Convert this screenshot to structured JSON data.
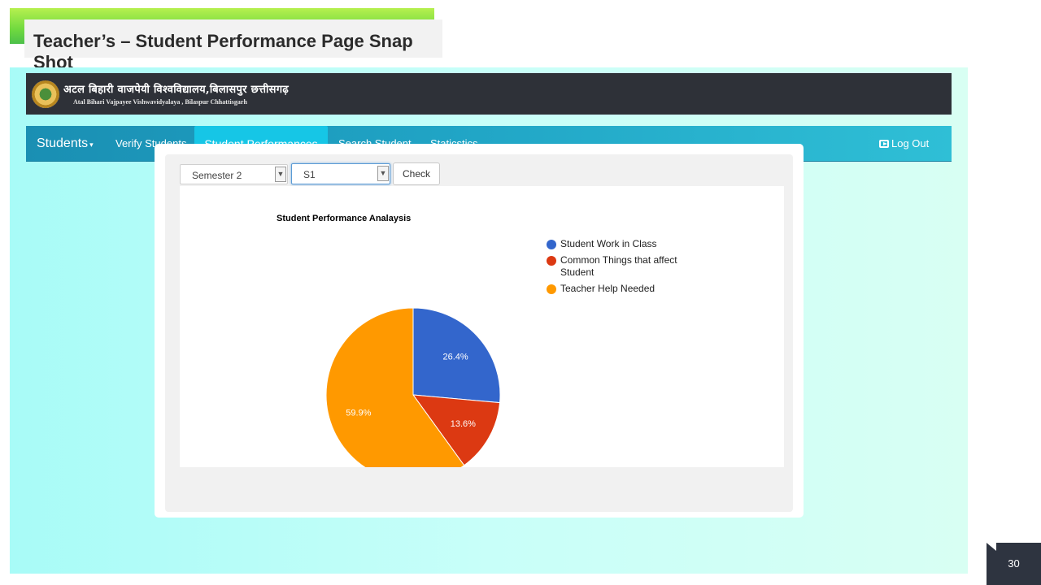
{
  "slide": {
    "title": "Teacher’s – Student Performance Page Snap Shot",
    "page_number": "30"
  },
  "header": {
    "university_hindi": "अटल बिहारी वाजपेयी विश्वविद्यालय,बिलासपुर छत्तीसगढ़",
    "university_english": "Atal Bihari Vajpayee Vishwavidyalaya , Bilaspur Chhattisgarh"
  },
  "nav": {
    "brand": "Students",
    "items": [
      {
        "label": "Verify Students"
      },
      {
        "label": "Student Performances",
        "active": true
      },
      {
        "label": "Search Student"
      },
      {
        "label": "Staticstics"
      }
    ],
    "logout": "Log Out"
  },
  "filters": {
    "semester": "Semester 2",
    "subject": "S1",
    "check_label": "Check"
  },
  "colors": {
    "accent_nav": "#1a8fb3",
    "active_tab": "#16c6e6",
    "blue": "#3366cc",
    "red": "#dc3912",
    "orange": "#ff9900"
  },
  "chart_data": {
    "type": "pie",
    "title": "Student Performance Analaysis",
    "legend_position": "right",
    "slices": [
      {
        "label": "Student Work in Class",
        "value": 26.4,
        "display": "26.4%",
        "color": "#3366cc"
      },
      {
        "label": "Common Things that affect Student",
        "value": 13.6,
        "display": "13.6%",
        "color": "#dc3912"
      },
      {
        "label": "Teacher Help Needed",
        "value": 59.9,
        "display": "59.9%",
        "color": "#ff9900"
      }
    ]
  }
}
